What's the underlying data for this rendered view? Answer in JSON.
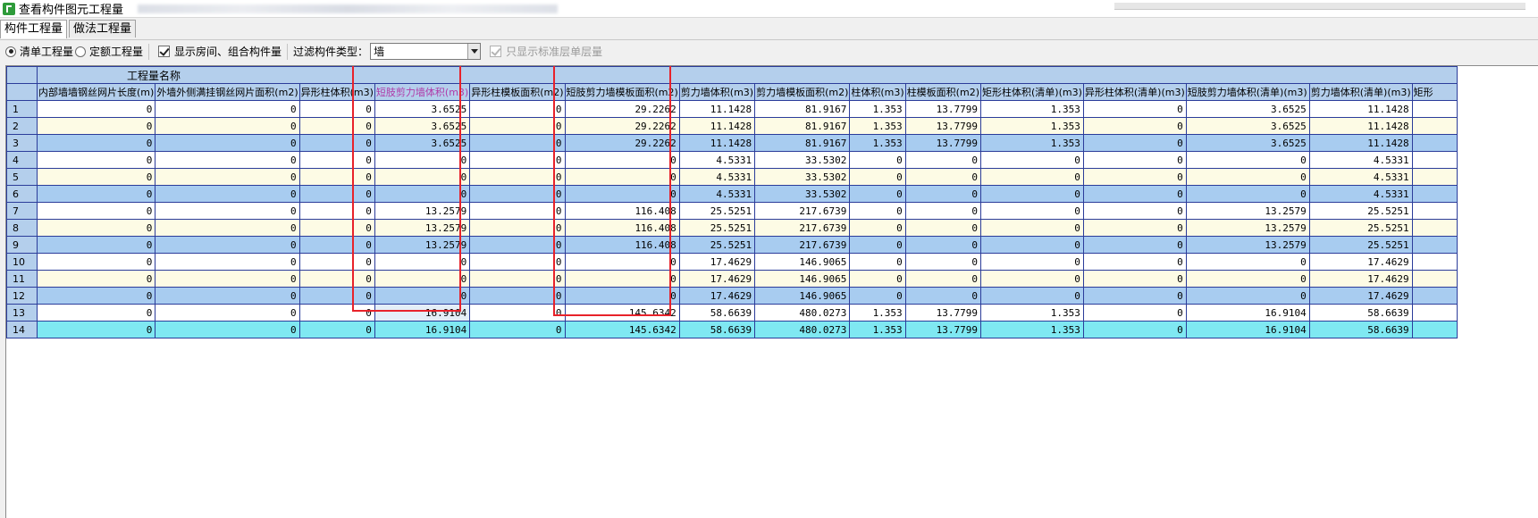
{
  "window": {
    "title": "查看构件图元工程量"
  },
  "tabs": [
    {
      "label": "构件工程量",
      "active": true
    },
    {
      "label": "做法工程量",
      "active": false
    }
  ],
  "toolbar": {
    "radio_list": "清单工程量",
    "radio_quota": "定额工程量",
    "check_show_rooms": "显示房间、组合构件量",
    "filter_label": "过滤构件类型：",
    "filter_value": "墙",
    "check_std_floor": "只显示标准层单层量"
  },
  "grid": {
    "group_header": "工程量名称",
    "columns": [
      "内部墙墙钢丝网片长度(m)",
      "外墙外侧满挂钢丝网片面积(m2)",
      "异形柱体积(m3)",
      "短肢剪力墙体积(m3)",
      "异形柱模板面积(m2)",
      "短肢剪力墙模板面积(m2)",
      "剪力墙体积(m3)",
      "剪力墙模板面积(m2)",
      "柱体积(m3)",
      "柱模板面积(m2)",
      "矩形柱体积(清单)(m3)",
      "异形柱体积(清单)(m3)",
      "短肢剪力墙体积(清单)(m3)",
      "剪力墙体积(清单)(m3)",
      "矩形"
    ],
    "rows": [
      {
        "n": "1",
        "v": [
          "0",
          "0",
          "0",
          "3.6525",
          "0",
          "29.2262",
          "11.1428",
          "81.9167",
          "1.353",
          "13.7799",
          "1.353",
          "0",
          "3.6525",
          "11.1428",
          ""
        ]
      },
      {
        "n": "2",
        "v": [
          "0",
          "0",
          "0",
          "3.6525",
          "0",
          "29.2262",
          "11.1428",
          "81.9167",
          "1.353",
          "13.7799",
          "1.353",
          "0",
          "3.6525",
          "11.1428",
          ""
        ]
      },
      {
        "n": "3",
        "v": [
          "0",
          "0",
          "0",
          "3.6525",
          "0",
          "29.2262",
          "11.1428",
          "81.9167",
          "1.353",
          "13.7799",
          "1.353",
          "0",
          "3.6525",
          "11.1428",
          ""
        ]
      },
      {
        "n": "4",
        "v": [
          "0",
          "0",
          "0",
          "0",
          "0",
          "0",
          "4.5331",
          "33.5302",
          "0",
          "0",
          "0",
          "0",
          "0",
          "4.5331",
          ""
        ]
      },
      {
        "n": "5",
        "v": [
          "0",
          "0",
          "0",
          "0",
          "0",
          "0",
          "4.5331",
          "33.5302",
          "0",
          "0",
          "0",
          "0",
          "0",
          "4.5331",
          ""
        ]
      },
      {
        "n": "6",
        "v": [
          "0",
          "0",
          "0",
          "0",
          "0",
          "0",
          "4.5331",
          "33.5302",
          "0",
          "0",
          "0",
          "0",
          "0",
          "4.5331",
          ""
        ]
      },
      {
        "n": "7",
        "v": [
          "0",
          "0",
          "0",
          "13.2579",
          "0",
          "116.408",
          "25.5251",
          "217.6739",
          "0",
          "0",
          "0",
          "0",
          "13.2579",
          "25.5251",
          ""
        ]
      },
      {
        "n": "8",
        "v": [
          "0",
          "0",
          "0",
          "13.2579",
          "0",
          "116.408",
          "25.5251",
          "217.6739",
          "0",
          "0",
          "0",
          "0",
          "13.2579",
          "25.5251",
          ""
        ]
      },
      {
        "n": "9",
        "v": [
          "0",
          "0",
          "0",
          "13.2579",
          "0",
          "116.408",
          "25.5251",
          "217.6739",
          "0",
          "0",
          "0",
          "0",
          "13.2579",
          "25.5251",
          ""
        ]
      },
      {
        "n": "10",
        "v": [
          "0",
          "0",
          "0",
          "0",
          "0",
          "0",
          "17.4629",
          "146.9065",
          "0",
          "0",
          "0",
          "0",
          "0",
          "17.4629",
          ""
        ]
      },
      {
        "n": "11",
        "v": [
          "0",
          "0",
          "0",
          "0",
          "0",
          "0",
          "17.4629",
          "146.9065",
          "0",
          "0",
          "0",
          "0",
          "0",
          "17.4629",
          ""
        ]
      },
      {
        "n": "12",
        "v": [
          "0",
          "0",
          "0",
          "0",
          "0",
          "0",
          "17.4629",
          "146.9065",
          "0",
          "0",
          "0",
          "0",
          "0",
          "17.4629",
          ""
        ]
      },
      {
        "n": "13",
        "v": [
          "0",
          "0",
          "0",
          "16.9104",
          "0",
          "145.6342",
          "58.6639",
          "480.0273",
          "1.353",
          "13.7799",
          "1.353",
          "0",
          "16.9104",
          "58.6639",
          ""
        ]
      },
      {
        "n": "14",
        "v": [
          "0",
          "0",
          "0",
          "16.9104",
          "0",
          "145.6342",
          "58.6639",
          "480.0273",
          "1.353",
          "13.7799",
          "1.353",
          "0",
          "16.9104",
          "58.6639",
          ""
        ]
      }
    ]
  },
  "colors": {
    "header_bg": "#b4cfec",
    "grid_border": "#2b3c9a",
    "row_white": "#ffffff",
    "row_cream": "#fdfbe5",
    "row_blue": "#a8ccf0",
    "row_selected": "#7fe8f2",
    "highlight_box": "#e8222a",
    "highlight_header_text": "#b03aa8"
  }
}
